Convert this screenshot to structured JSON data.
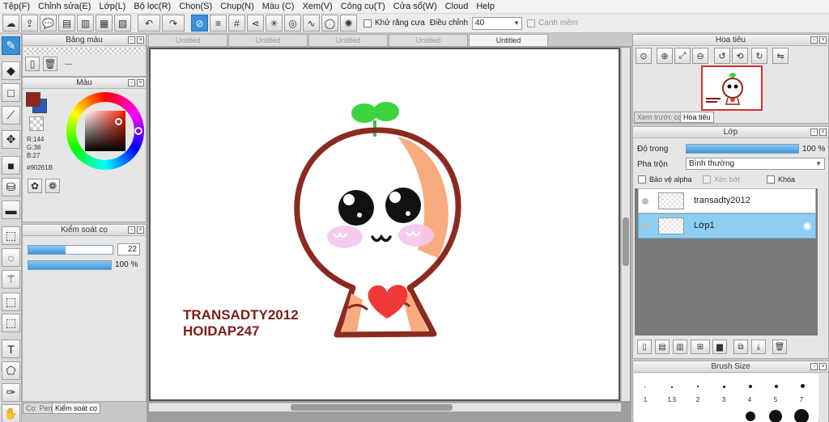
{
  "menu": [
    "Tệp(F)",
    "Chỉnh sửa(E)",
    "Lớp(L)",
    "Bộ lọc(R)",
    "Chọn(S)",
    "Chụp(N)",
    "Màu (C)",
    "Xem(V)",
    "Công cụ(T)",
    "Cửa sổ(W)",
    "Cloud",
    "Help"
  ],
  "toolbar": {
    "antialias_label": "Khử răng cưa",
    "correction_label": "Điều chỉnh",
    "correction_value": "40",
    "blur_edge_label": "Cạnh mềm"
  },
  "panels": {
    "swatch_title": "Bảng màu",
    "swatch_value": "---",
    "color_title": "Màu",
    "color": {
      "r": "R:144",
      "g": "G:38",
      "b": "B:27",
      "hex": "#90261B",
      "primary": "#90261B",
      "secondary": "#2a5cc0"
    },
    "brush_title": "Kiểm soát cọ",
    "brush_size": "22",
    "brush_size_fraction": 0.44,
    "brush_opacity": "100 %",
    "brush_opacity_fraction": 1.0,
    "bottom_tabs": [
      "Cọ: Pen",
      "Kiểm soát cọ"
    ]
  },
  "document_tabs": [
    "Untitled",
    "Untitled",
    "Untitled",
    "Untitled",
    "Untitled"
  ],
  "artwork": {
    "line1": "TRANSADTY2012",
    "line2": "HOIDAP247"
  },
  "navigator": {
    "title": "Hoa tiêu",
    "tabs": [
      "Xem trước cọ",
      "Hoa tiêu"
    ]
  },
  "layers": {
    "title": "Lớp",
    "opacity_label": "Độ trong",
    "opacity_value": "100 %",
    "opacity_fraction": 1.0,
    "blend_label": "Pha trộn",
    "blend_value": "Bình thường",
    "protect_alpha": "Bảo vệ alpha",
    "clipping": "Xén bớt",
    "lock": "Khóa",
    "items": [
      {
        "name": "transadty2012",
        "selected": false
      },
      {
        "name": "Lớp1",
        "selected": true
      }
    ]
  },
  "brush_size_panel": {
    "title": "Brush Size",
    "sizes": [
      "1",
      "1.5",
      "2",
      "3",
      "4",
      "5",
      "7"
    ]
  }
}
